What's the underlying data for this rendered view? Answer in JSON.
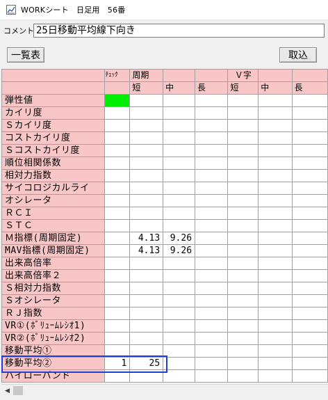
{
  "window": {
    "title": "WORKシート　日足用　56番",
    "icon": "chart-app-icon"
  },
  "comment": {
    "label": "コメント",
    "value": "25日移動平均線下向き"
  },
  "toolbar": {
    "list_label": "一覧表",
    "load_label": "取込"
  },
  "grid": {
    "header_row1": [
      "",
      "ﾁｪｯｸ",
      "周期",
      "",
      "",
      "Ｖ字",
      "",
      ""
    ],
    "header_row2": [
      "",
      "",
      "短",
      "中",
      "長",
      "短",
      "中",
      "長"
    ],
    "rows": [
      {
        "label": "弾性値",
        "check": "",
        "short": "",
        "mid": "",
        "checked_green": true
      },
      {
        "label": "カイリ度",
        "check": "",
        "short": "",
        "mid": ""
      },
      {
        "label": "Ｓカイリ度",
        "check": "",
        "short": "",
        "mid": ""
      },
      {
        "label": "コストカイリ度",
        "check": "",
        "short": "",
        "mid": ""
      },
      {
        "label": "Ｓコストカイリ度",
        "check": "",
        "short": "",
        "mid": ""
      },
      {
        "label": "順位相関係数",
        "check": "",
        "short": "",
        "mid": ""
      },
      {
        "label": "相対力指数",
        "check": "",
        "short": "",
        "mid": ""
      },
      {
        "label": "サイコロジカルライ",
        "check": "",
        "short": "",
        "mid": ""
      },
      {
        "label": "オシレータ",
        "check": "",
        "short": "",
        "mid": ""
      },
      {
        "label": "ＲＣＩ",
        "check": "",
        "short": "",
        "mid": ""
      },
      {
        "label": "ＳＴＣ",
        "check": "",
        "short": "",
        "mid": ""
      },
      {
        "label": "Ｍ指標(周期固定)",
        "check": "",
        "short": "4.13",
        "mid": "9.26"
      },
      {
        "label": "MAV指標(周期固定)",
        "check": "",
        "short": "4.13",
        "mid": "9.26"
      },
      {
        "label": "出来高倍率",
        "check": "",
        "short": "",
        "mid": ""
      },
      {
        "label": "出来高倍率２",
        "check": "",
        "short": "",
        "mid": ""
      },
      {
        "label": "Ｓ相対力指数",
        "check": "",
        "short": "",
        "mid": ""
      },
      {
        "label": "Ｓオシレータ",
        "check": "",
        "short": "",
        "mid": ""
      },
      {
        "label": "ＲＪ指数",
        "check": "",
        "short": "",
        "mid": ""
      },
      {
        "label": "VR①(ﾎﾞﾘｭｰﾑﾚｼｵ1)",
        "check": "",
        "short": "",
        "mid": ""
      },
      {
        "label": "VR②(ﾎﾞﾘｭｰﾑﾚｼｵ2)",
        "check": "",
        "short": "",
        "mid": ""
      },
      {
        "label": "移動平均①",
        "check": "",
        "short": "",
        "mid": ""
      },
      {
        "label": "移動平均②",
        "check": "1",
        "short": "25",
        "mid": ""
      },
      {
        "label": "ハイローバンド",
        "check": "",
        "short": "",
        "mid": ""
      }
    ]
  },
  "colors": {
    "header_pink": "#f8c6c6",
    "check_green": "#00ee00",
    "selection_blue": "#1f3fcf"
  },
  "scrollbar": {
    "left_arrow_icon": "arrow-left-icon"
  }
}
